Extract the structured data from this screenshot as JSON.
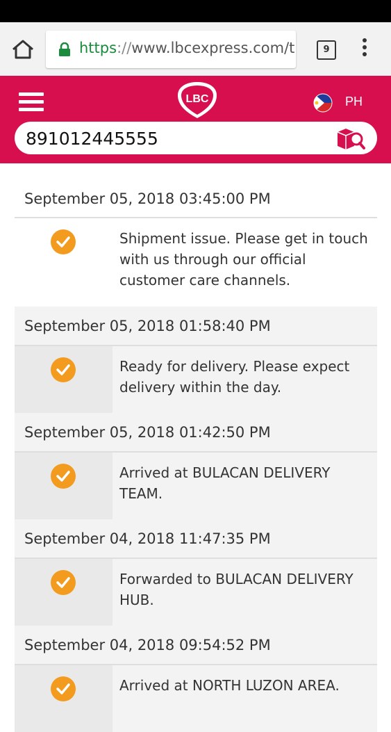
{
  "browser": {
    "url_scheme": "https",
    "url_sep": "://",
    "url_rest": "www.lbcexpress.com/tr",
    "tab_count": "9",
    "secure_color": "#1a8a3c"
  },
  "header": {
    "logo_text": "LBC",
    "country": "PH",
    "brand_color": "#d80f4e"
  },
  "search": {
    "value": "891012445555",
    "icon": "package-search-icon"
  },
  "timeline": [
    {
      "date": "September 05, 2018 03:45:00 PM",
      "status": "Shipment issue. Please get in touch with us through our official customer care channels."
    },
    {
      "date": "September 05, 2018 01:58:40 PM",
      "status": "Ready for delivery. Please expect delivery within the day."
    },
    {
      "date": "September 05, 2018 01:42:50 PM",
      "status": "Arrived at BULACAN DELIVERY TEAM."
    },
    {
      "date": "September 04, 2018 11:47:35 PM",
      "status": "Forwarded to BULACAN DELIVERY HUB."
    },
    {
      "date": "September 04, 2018 09:54:52 PM",
      "status": "Arrived at NORTH LUZON AREA."
    }
  ],
  "check_color": "#f39b1e"
}
